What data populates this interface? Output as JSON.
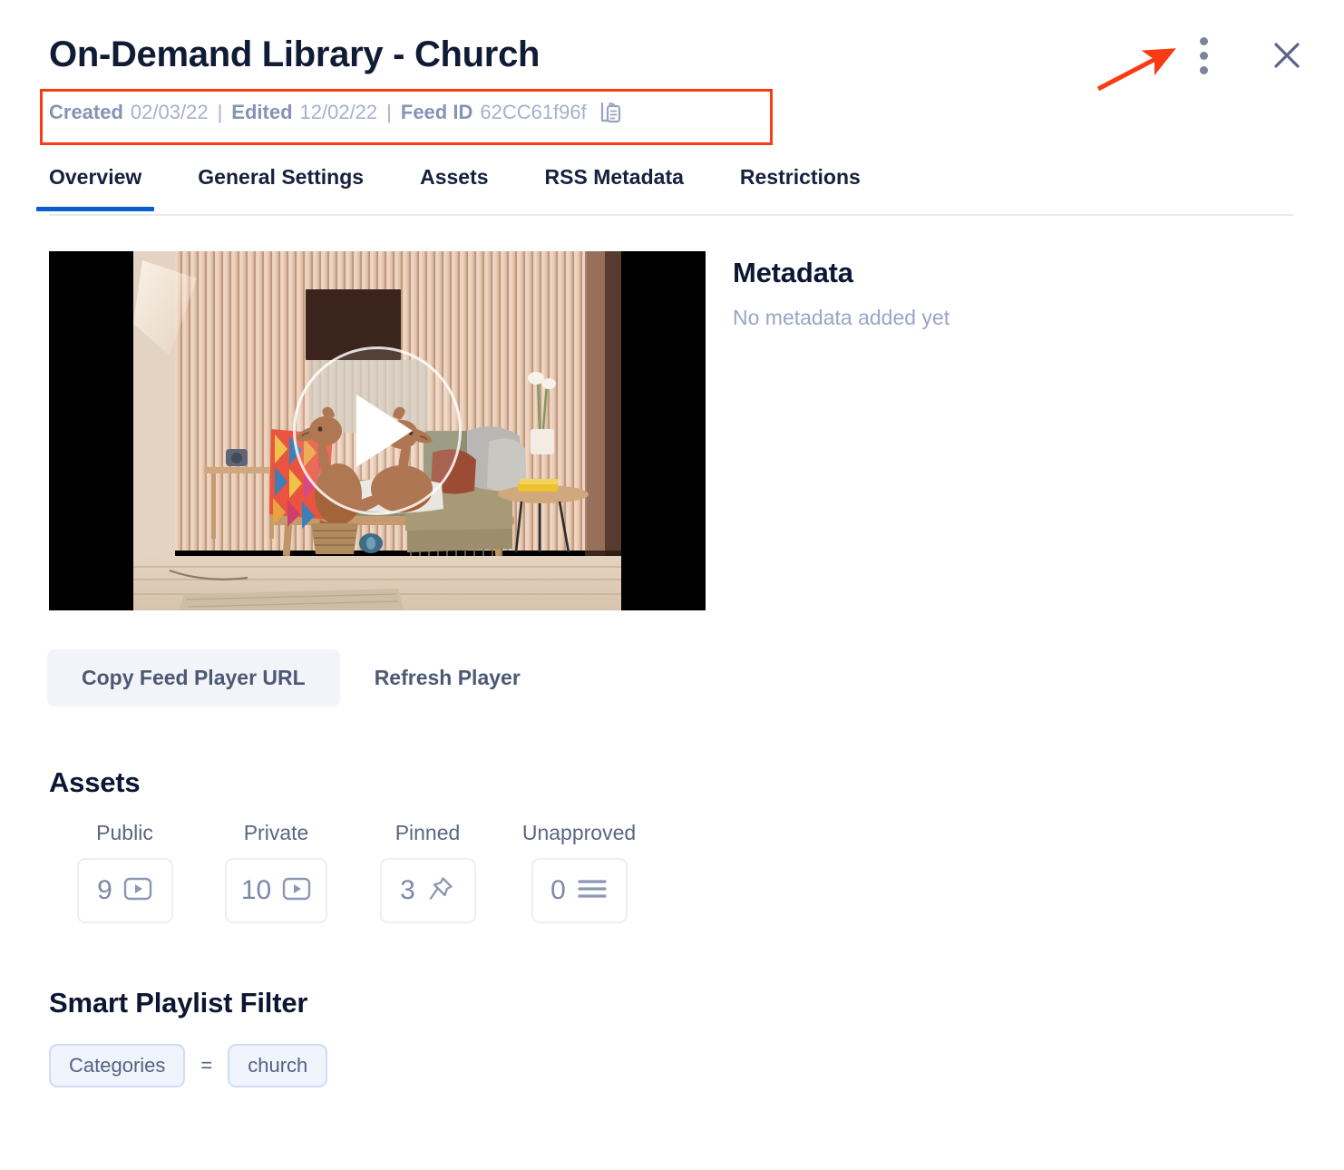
{
  "header": {
    "title": "On-Demand Library - Church",
    "meta": {
      "created_label": "Created",
      "created_value": "02/03/22",
      "sep1": "|",
      "edited_label": "Edited",
      "edited_value": "12/02/22",
      "sep2": "|",
      "feed_id_label": "Feed ID",
      "feed_id_value": "62CC61f96f",
      "copy_icon": "copy-clipboard-icon"
    },
    "actions": {
      "kebab_icon": "more-vertical-icon",
      "close_icon": "close-icon"
    },
    "annotation": {
      "type": "arrow",
      "color": "#f93b13",
      "points_to": "more-vertical-icon",
      "highlight_box_color": "#fa3c14"
    }
  },
  "tabs": [
    {
      "label": "Overview",
      "active": true
    },
    {
      "label": "General Settings",
      "active": false
    },
    {
      "label": "Assets",
      "active": false
    },
    {
      "label": "RSS Metadata",
      "active": false
    },
    {
      "label": "Restrictions",
      "active": false
    }
  ],
  "player": {
    "play_icon": "play-button-icon",
    "poster_description": "Two brown dogs sitting on a couch in a wood-panelled room"
  },
  "player_buttons": [
    {
      "label": "Copy Feed Player URL",
      "style": "filled"
    },
    {
      "label": "Refresh Player",
      "style": "plain"
    }
  ],
  "metadata": {
    "heading": "Metadata",
    "empty_text": "No metadata added yet"
  },
  "assets": {
    "heading": "Assets",
    "items": [
      {
        "label": "Public",
        "count": "9",
        "icon": "video-play-icon"
      },
      {
        "label": "Private",
        "count": "10",
        "icon": "video-play-icon"
      },
      {
        "label": "Pinned",
        "count": "3",
        "icon": "pin-icon"
      },
      {
        "label": "Unapproved",
        "count": "0",
        "icon": "list-icon"
      }
    ]
  },
  "smart_playlist_filter": {
    "heading": "Smart Playlist Filter",
    "rule": {
      "field": "Categories",
      "operator": "=",
      "value": "church"
    }
  },
  "colors": {
    "accent_blue": "#0b5ccd",
    "title_navy": "#101b35",
    "muted_slate": "#9aa5c4",
    "annotation_red": "#f93b13",
    "chip_bg": "#eff4fd"
  }
}
